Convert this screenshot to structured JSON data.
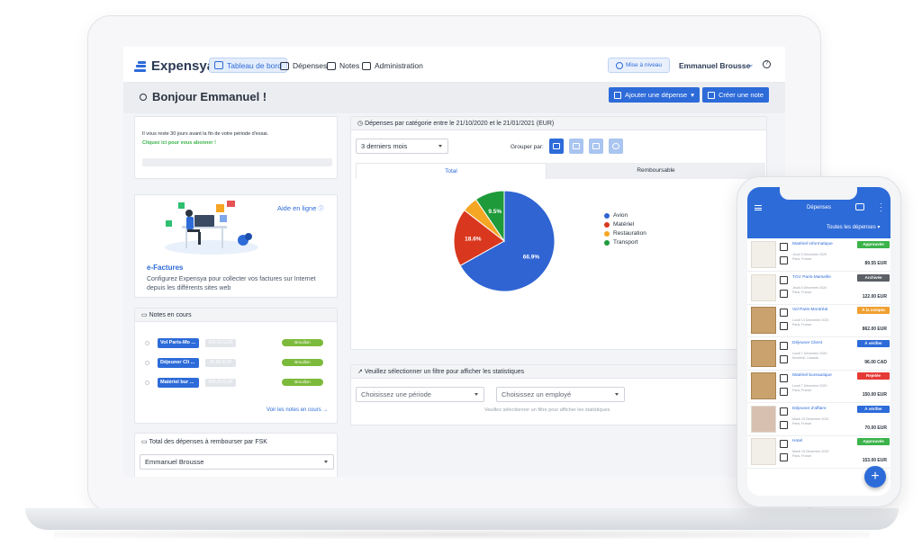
{
  "nav": {
    "brand": "Expensya",
    "items": [
      {
        "label": "Tableau de bord",
        "icon": "dashboard-icon"
      },
      {
        "label": "Dépenses",
        "icon": "receipt-icon"
      },
      {
        "label": "Notes",
        "icon": "folder-icon"
      },
      {
        "label": "Administration",
        "icon": "admin-icon"
      }
    ],
    "upgrade": "Mise à niveau",
    "user": "Emmanuel Brousse"
  },
  "header": {
    "greeting": "Bonjour Emmanuel !",
    "add_expense": "Ajouter une dépense",
    "create_note": "Créer une note"
  },
  "trial": {
    "line1": "Il vous reste 30 jours avant la fin de votre période d'essai.",
    "line2": "Cliquez ici pour vous abonner !"
  },
  "efactures": {
    "help_link": "Aide en ligne",
    "title": "e-Factures",
    "description": "Configurez Expensya pour collecter vos factures sur Internet depuis les différents sites web"
  },
  "notes": {
    "title": "Notes en cours",
    "rows": [
      {
        "label": "Vol Paris-Mo ...",
        "amount": "000,00 EUR",
        "status": "Brouillon"
      },
      {
        "label": "Déjeuner Cli ...",
        "amount": "00,00 EUR",
        "status": "Brouillon"
      },
      {
        "label": "Matériel bur ...",
        "amount": "000,00 EUR",
        "status": "Brouillon"
      }
    ],
    "see_all": "Voir les notes en cours →"
  },
  "reimburse": {
    "title": "Total des dépenses à rembourser par FSK",
    "selected": "Emmanuel Brousse"
  },
  "category_chart": {
    "title": "Dépenses par catégorie entre le 21/10/2020 et le 21/01/2021 (EUR)",
    "period": "3 derniers mois",
    "group_by": "Grouper par:",
    "tabs": [
      "Total",
      "Remboursable"
    ]
  },
  "chart_data": {
    "type": "pie",
    "categories": [
      "Avion",
      "Matériel",
      "Restauration",
      "Transport"
    ],
    "values": [
      66.9,
      18.6,
      5.0,
      9.5
    ],
    "labels": [
      "66.9%",
      "18.6%",
      "",
      "9.5%"
    ],
    "colors": [
      "#2f64d2",
      "#d9381e",
      "#f5a623",
      "#1e9a3a"
    ],
    "legend": "right"
  },
  "stats": {
    "title": "Veuillez sélectionner un filtre pour afficher les statistiques",
    "period_placeholder": "Choisissez une période",
    "employee_placeholder": "Choisissez un employé",
    "hint": "Veuillez sélectionner un filtre pour afficher les statistiques"
  },
  "phone": {
    "title": "Dépenses",
    "filter": "Toutes les dépenses ▾",
    "items": [
      {
        "name": "Matériel informatique",
        "date": "Jeudi 3 Décembre 2020",
        "place": "Paris, France",
        "status": "Approuvée",
        "status_color": "#3bb34a",
        "amount": "89.55 EUR",
        "thumb": "light"
      },
      {
        "name": "TGV Paris-Marseille",
        "date": "Jeudi 4 Décembre 2020",
        "place": "Paris, France",
        "status": "Archivée",
        "status_color": "#5b5f66",
        "amount": "122.00 EUR",
        "thumb": "light"
      },
      {
        "name": "Vol Paris-Montréal",
        "date": "Lundi 14 Décembre 2020",
        "place": "Paris, France",
        "status": "À la compta",
        "status_color": "#f0a030",
        "amount": "862.00 EUR",
        "thumb": "dark"
      },
      {
        "name": "Déjeuner Client",
        "date": "Lundi 7 Décembre 2020",
        "place": "Montréal, Canada",
        "status": "À vérifier",
        "status_color": "#2d6bd9",
        "amount": "96.00 CAD",
        "thumb": "dark"
      },
      {
        "name": "Matériel bureautique",
        "date": "Lundi 7 Décembre 2020",
        "place": "Paris, France",
        "status": "Rejetée",
        "status_color": "#e53935",
        "amount": "150.00 EUR",
        "thumb": "dark"
      },
      {
        "name": "Déjeuner d'affaire",
        "date": "Mardi 15 Décembre 2020",
        "place": "Paris, France",
        "status": "À vérifier",
        "status_color": "#2d6bd9",
        "amount": "70.00 EUR",
        "thumb": "red"
      },
      {
        "name": "Hotel",
        "date": "Mardi 15 Décembre 2020",
        "place": "Paris, France",
        "status": "Approuvée",
        "status_color": "#3bb34a",
        "amount": "153.00 EUR",
        "thumb": "light"
      }
    ]
  }
}
